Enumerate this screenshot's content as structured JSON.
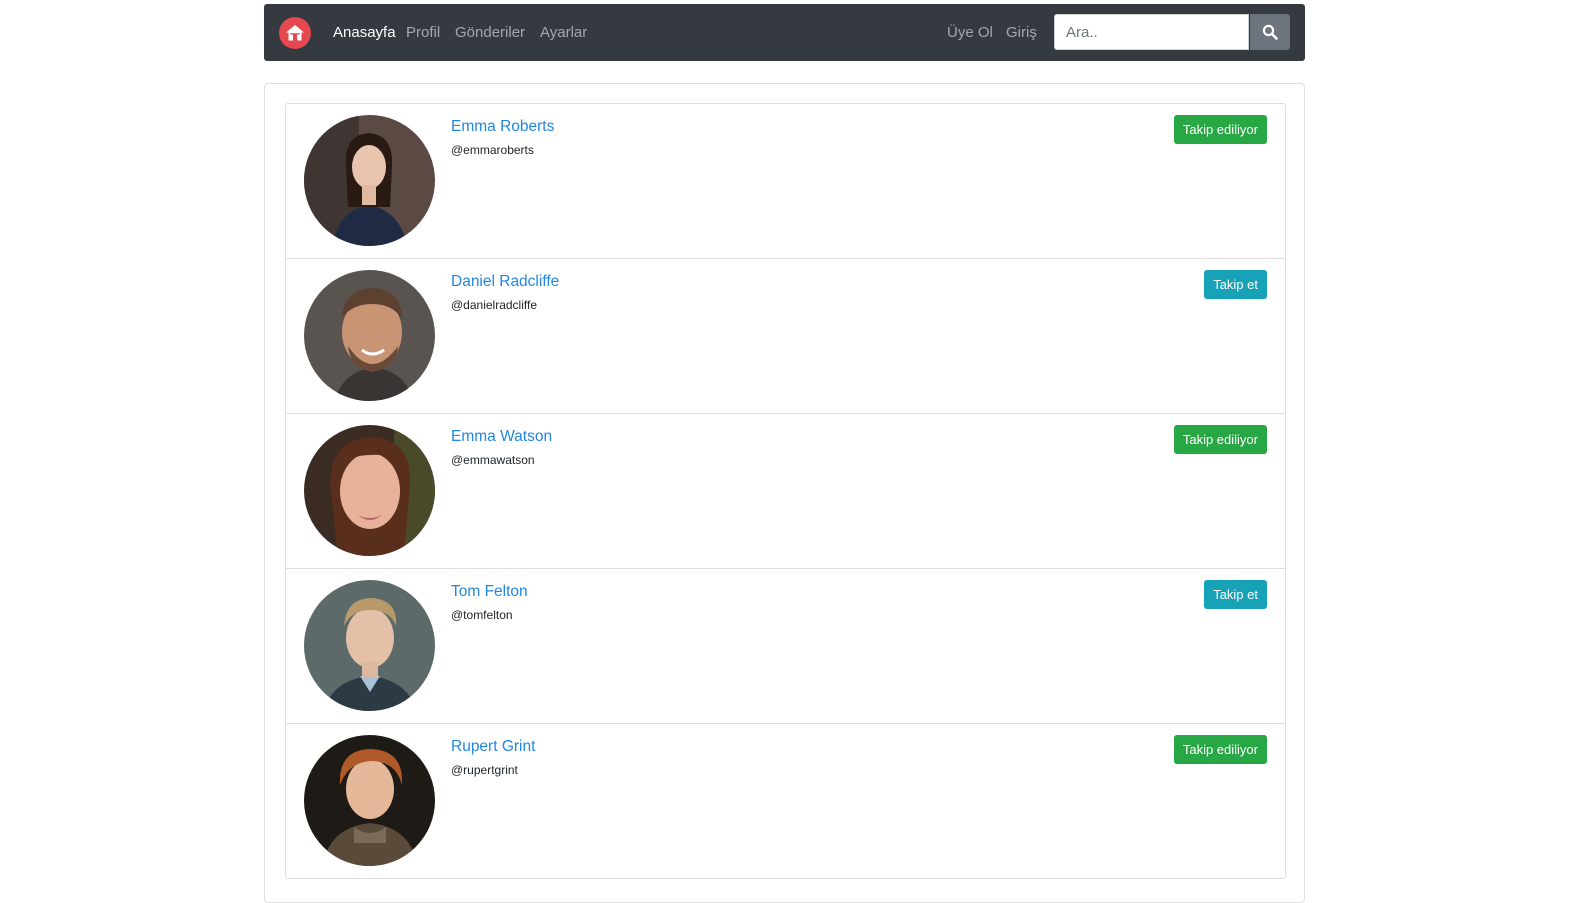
{
  "navbar": {
    "links": [
      {
        "label": "Anasayfa",
        "active": true
      },
      {
        "label": "Profil",
        "active": false
      },
      {
        "label": "Gönderiler",
        "active": false
      },
      {
        "label": "Ayarlar",
        "active": false
      }
    ],
    "right_links": [
      "Üye Ol",
      "Giriş"
    ],
    "search": {
      "placeholder": "Ara..",
      "value": ""
    },
    "brand_icon": "home-icon",
    "search_icon": "search-icon",
    "brand_color": "#e5484f"
  },
  "users": [
    {
      "name": "Emma Roberts",
      "handle": "@emmaroberts",
      "button": "Takip ediliyor",
      "status": "following"
    },
    {
      "name": "Daniel Radcliffe",
      "handle": "@danielradcliffe",
      "button": "Takip et",
      "status": "follow"
    },
    {
      "name": "Emma Watson",
      "handle": "@emmawatson",
      "button": "Takip ediliyor",
      "status": "following"
    },
    {
      "name": "Tom Felton",
      "handle": "@tomfelton",
      "button": "Takip et",
      "status": "follow"
    },
    {
      "name": "Rupert Grint",
      "handle": "@rupertgrint",
      "button": "Takip ediliyor",
      "status": "following"
    }
  ],
  "colors": {
    "navbar_bg": "#343a40",
    "link_blue": "#2287e0",
    "following_green": "#28a745",
    "follow_teal": "#17a2b8",
    "search_btn": "#6c757d"
  }
}
